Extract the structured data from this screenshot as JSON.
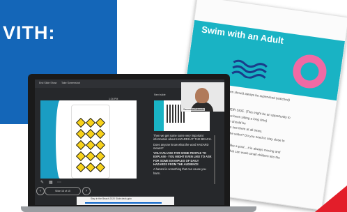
{
  "banner": {
    "headline": "VITH:",
    "color": "#1466b8"
  },
  "handout": {
    "title": "Swim with an Adult",
    "accent": "#19b3c4",
    "body": [
      "... where you relax ... children should always be supervised (watched)",
      "... your child at arm length.",
      "... and your kids.",
      "... KIDS REACH OUT TO THEIR SIDE. (This might be an opportunity to",
      "... up for a moment if they have been sitting a long time)",
      "... to close your young children should be",
      "... others, you should be able to see them at all times.",
      "... be playing in the sand near the water? Do you need to stay close to",
      "... the children?",
      "... the water on the beach is not like a pool... it is always moving and",
      "... can be sudden bigger waves that can wash small children into the"
    ]
  },
  "presenter": {
    "topbar": {
      "left": "End Slide Show",
      "middle": "Take Screenshot",
      "time": "1:26 PM"
    },
    "slide_counter": "Slide 16 of 15",
    "next_slide_label": "Next slide",
    "video_caption": "Samantha Edwards",
    "notes": [
      "Then we get some some very important information about HAZARDS AT THE BEACH.",
      "Does anyone know what the word HAZARD means?",
      "YOU CAN ASK FOR SOME PEOPLE TO EXPLAIN - YOU MIGHT EVEN LIKE TO ASK FOR SOME EXAMPLES OF DAILY HAZARDS FROM THE AUDIENCE",
      "A hazard is something that can cause you harm."
    ],
    "taskbar_title": "Stay in the Beach 2020 Slide deck.pptx"
  }
}
